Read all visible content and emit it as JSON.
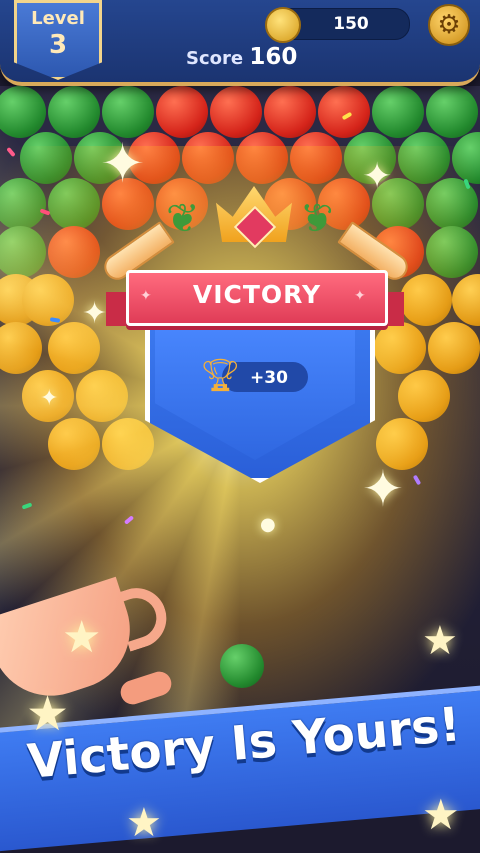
{
  "hud": {
    "level_label": "Level",
    "level_number": "3",
    "coins": "150",
    "score_label": "Score",
    "score_value": "160",
    "settings_icon": "gear-icon"
  },
  "victory": {
    "title": "VICTORY",
    "reward": "+30",
    "reward_icon": "trophy-icon"
  },
  "banner": {
    "text": "Victory Is Yours!"
  },
  "colors": {
    "hud_blue": "#1b3471",
    "ribbon_red": "#e03c57",
    "shield_blue": "#2f67e0",
    "banner_blue": "#2a58cf",
    "bubble_green": "#238a2e",
    "bubble_red": "#d5241a",
    "bubble_gold": "#dd9514"
  }
}
